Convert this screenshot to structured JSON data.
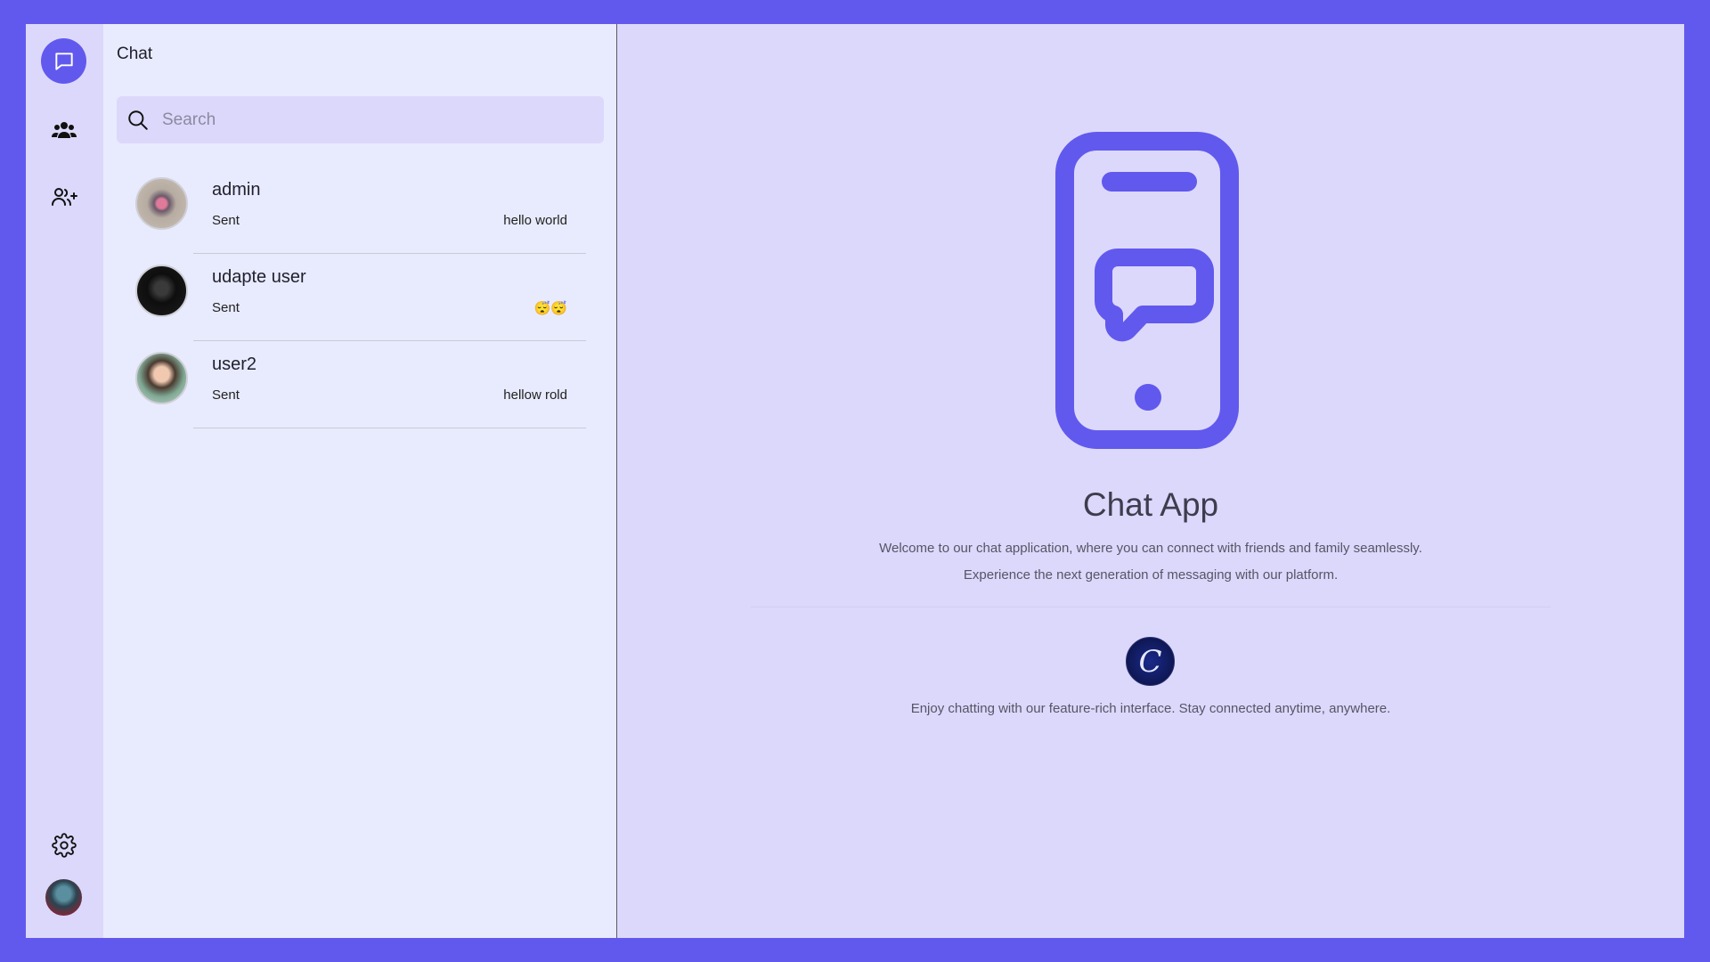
{
  "panel": {
    "title": "Chat",
    "search_placeholder": "Search"
  },
  "rail": {
    "items": [
      "chat",
      "groups",
      "add-friend"
    ],
    "bottom": [
      "settings",
      "profile"
    ]
  },
  "chats": [
    {
      "name": "admin",
      "status": "Sent",
      "last_message": "hello world"
    },
    {
      "name": "udapte user",
      "status": "Sent",
      "last_message": "😴😴"
    },
    {
      "name": "user2",
      "status": "Sent",
      "last_message": "hellow rold"
    }
  ],
  "welcome": {
    "title": "Chat App",
    "line1": "Welcome to our chat application, where you can connect with friends and family seamlessly.",
    "line2": "Experience the next generation of messaging with our platform.",
    "footer": "Enjoy chatting with our feature-rich interface. Stay connected anytime, anywhere.",
    "logo_letter": "C"
  },
  "colors": {
    "accent": "#6159ee",
    "rail_bg": "#dcd8fb",
    "panel_bg": "#e8ebfd"
  }
}
